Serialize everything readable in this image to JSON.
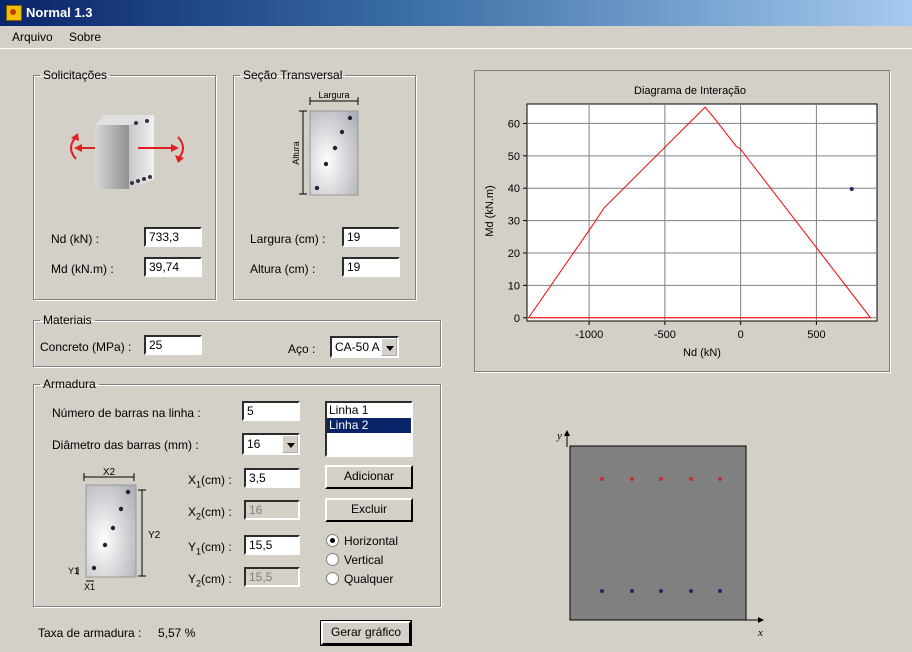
{
  "window": {
    "title": "Normal 1.3"
  },
  "menu": [
    "Arquivo",
    "Sobre"
  ],
  "solicitacoes": {
    "legend": "Solicitações",
    "nd_label": "Nd (kN) :",
    "nd_value": "733,3",
    "md_label": "Md (kN.m) :",
    "md_value": "39,74"
  },
  "secao": {
    "legend": "Seção Transversal",
    "fig_largura": "Largura",
    "fig_altura": "Altura",
    "largura_label": "Largura (cm) :",
    "largura_value": "19",
    "altura_label": "Altura (cm) :",
    "altura_value": "19"
  },
  "materiais": {
    "legend": "Materiais",
    "concreto_label": "Concreto (MPa) :",
    "concreto_value": "25",
    "aco_label": "Aço :",
    "aco_value": "CA-50 A"
  },
  "armadura": {
    "legend": "Armadura",
    "nbarras_label": "Número de barras na linha :",
    "nbarras_value": "5",
    "diametro_label": "Diâmetro das barras (mm) :",
    "diametro_value": "16",
    "lines": [
      "Linha 1",
      "Linha 2"
    ],
    "x1_label": "X1(cm) :",
    "x1_value": "3,5",
    "x2_label": "X2(cm) :",
    "x2_value": "16",
    "y1_label": "Y1(cm) :",
    "y1_value": "15,5",
    "y2_label": "Y2(cm) :",
    "y2_value": "15,5",
    "fig_x2": "X2",
    "fig_y2": "Y2",
    "fig_y1": "Y1",
    "fig_x1": "X1",
    "btn_add": "Adicionar",
    "btn_del": "Excluir",
    "radios": [
      "Horizontal",
      "Vertical",
      "Qualquer"
    ],
    "radio_selected": "Horizontal"
  },
  "taxa": {
    "label": "Taxa de armadura :",
    "value": "5,57 %"
  },
  "gerar_button": "Gerar gráfico",
  "colors": {
    "curve": "#ff0000",
    "point": "#1a2a6a",
    "bar_top": "#c03030",
    "bar_bottom": "#1a2a6a",
    "section": "#808080"
  },
  "chart_data": {
    "type": "line",
    "title": "Diagrama de Interação",
    "xlabel": "Nd (kN)",
    "ylabel": "Md (kN.m)",
    "xlim": [
      -1410,
      900
    ],
    "ylim": [
      -1,
      66
    ],
    "xticks": [
      -1000,
      -500,
      0,
      500
    ],
    "yticks": [
      0,
      10,
      20,
      30,
      40,
      50,
      60
    ],
    "grid": true,
    "series": [
      {
        "values": [
          [
            -1400,
            0
          ],
          [
            -1000,
            27
          ],
          [
            -900,
            34
          ],
          [
            -235,
            65
          ],
          [
            -180,
            62
          ],
          [
            -30,
            53
          ],
          [
            0,
            52
          ],
          [
            857,
            0
          ],
          [
            -1400,
            0
          ]
        ]
      }
    ],
    "points": [
      [
        733.3,
        39.74
      ]
    ]
  },
  "section": {
    "y_label": "y",
    "x_label": "x",
    "top_bars": 5,
    "bottom_bars": 5
  }
}
